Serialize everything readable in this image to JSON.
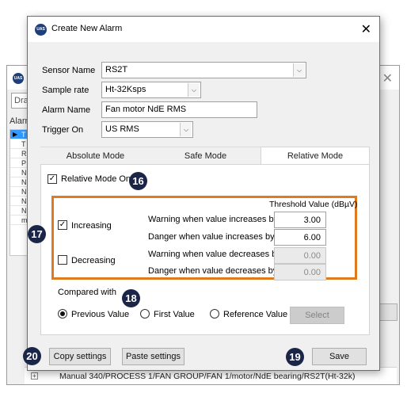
{
  "background_window": {
    "logo_text": "UAS",
    "search_text": "Dra",
    "list_label": "Alarm",
    "rows": [
      "T",
      "T",
      "R",
      "P",
      "N",
      "N",
      "N",
      "N",
      "N",
      "m"
    ],
    "tree_path": "Manual 340/PROCESS 1/FAN GROUP/FAN 1/motor/NdE bearing/RS2T(Ht-32k)"
  },
  "dialog": {
    "logo_text": "UAS",
    "title": "Create New Alarm",
    "close_glyph": "✕",
    "sensor_name_label": "Sensor Name",
    "sensor_name_value": "RS2T",
    "sample_rate_label": "Sample rate",
    "sample_rate_value": "Ht-32Ksps",
    "alarm_name_label": "Alarm Name",
    "alarm_name_value": "Fan motor NdE RMS",
    "trigger_on_label": "Trigger On",
    "trigger_on_value": "US RMS",
    "tabs": [
      "Absolute Mode",
      "Safe Mode",
      "Relative Mode"
    ],
    "active_tab": "Relative Mode",
    "relative_mode_on_label": "Relative Mode On",
    "relative_mode_on_checked": true,
    "threshold_header": "Threshold Value (dBµV)",
    "increasing": {
      "label": "Increasing",
      "checked": true,
      "warning_label": "Warning when value increases by",
      "warning_value": "3.00",
      "danger_label": "Danger when value increases by",
      "danger_value": "6.00"
    },
    "decreasing": {
      "label": "Decreasing",
      "checked": false,
      "warning_label": "Warning when value decreases by",
      "warning_value": "0.00",
      "danger_label": "Danger when value decreases by",
      "danger_value": "0.00"
    },
    "compared_with_label": "Compared with",
    "compare_options": [
      "Previous Value",
      "First Value",
      "Reference Value"
    ],
    "compare_selected": "Previous Value",
    "select_button": "Select",
    "copy_settings_button": "Copy settings",
    "paste_settings_button": "Paste settings",
    "save_button": "Save"
  },
  "badges": [
    "16",
    "17",
    "18",
    "19",
    "20"
  ],
  "colors": {
    "highlight_box": "#e07a1e",
    "badge": "#1b2548",
    "selection": "#3399ff"
  },
  "icons": {
    "dropdown": "chevron-down-icon",
    "close": "close-icon",
    "check": "checkmark-icon"
  }
}
